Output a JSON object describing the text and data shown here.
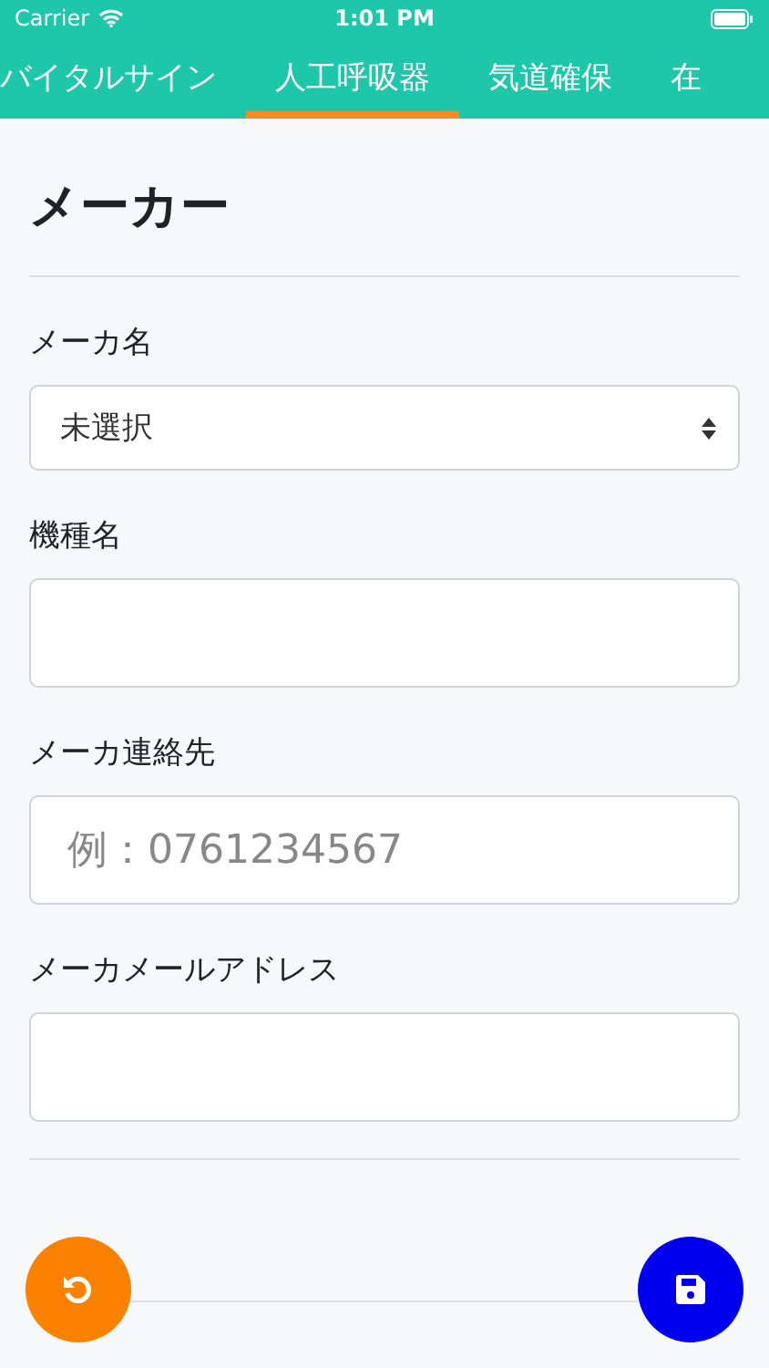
{
  "status_bar": {
    "carrier": "Carrier",
    "time": "1:01 PM"
  },
  "tabs": [
    {
      "label": "バイタルサイン",
      "selected": false
    },
    {
      "label": "人工呼吸器",
      "selected": true
    },
    {
      "label": "気道確保",
      "selected": false
    },
    {
      "label": "在",
      "selected": false
    }
  ],
  "sections": [
    {
      "title": "メーカー",
      "fields": [
        {
          "label": "メーカ名",
          "kind": "select",
          "value": "未選択"
        },
        {
          "label": "機種名",
          "kind": "text"
        },
        {
          "label": "メーカ連絡先",
          "kind": "text",
          "placeholder": "例：0761234567"
        },
        {
          "label": "メーカメールアドレス",
          "kind": "text"
        }
      ]
    }
  ],
  "fabs": [
    {
      "kind": "undo"
    },
    {
      "kind": "save"
    }
  ]
}
